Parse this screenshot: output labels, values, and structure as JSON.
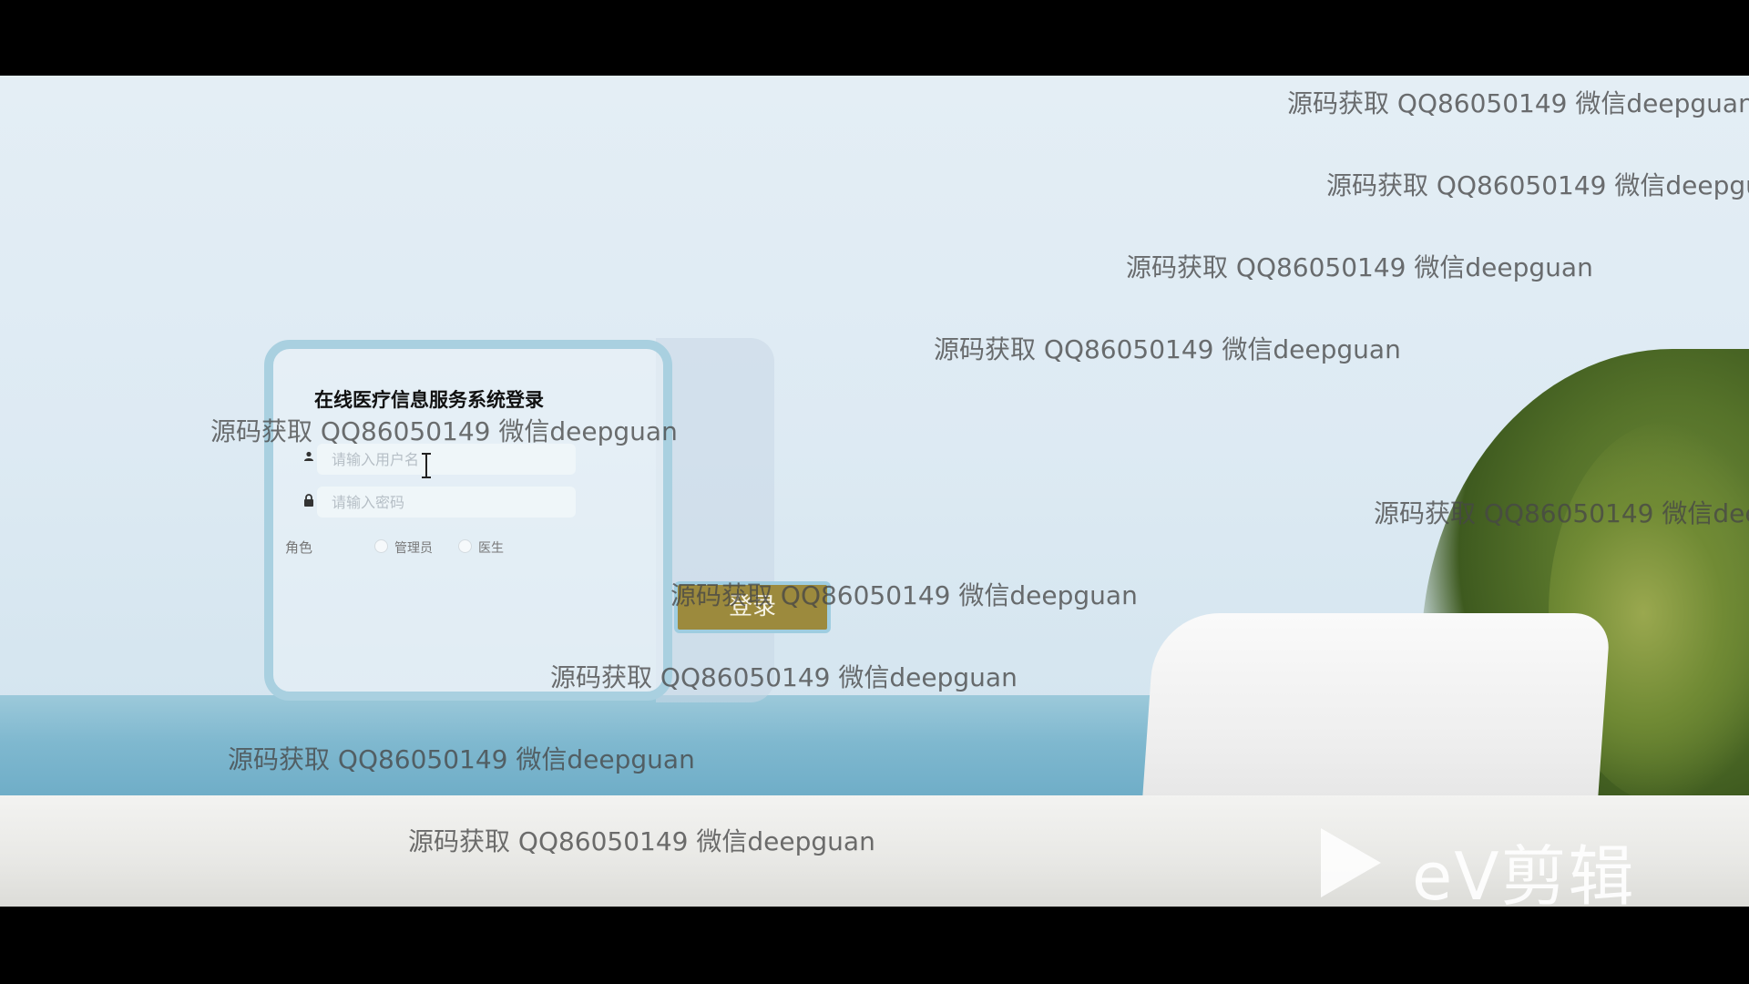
{
  "login": {
    "title": "在线医疗信息服务系统登录",
    "username_placeholder": "请输入用户名",
    "password_placeholder": "请输入密码",
    "role_label": "角色",
    "roles": [
      "管理员",
      "医生"
    ],
    "submit_label": "登录"
  },
  "watermark": {
    "text": "源码获取 QQ86050149 微信deepguan"
  },
  "editor_logo": {
    "text": "eV剪辑"
  },
  "colors": {
    "button": "#9c8a3d",
    "card_border": "#a9d0e0"
  }
}
